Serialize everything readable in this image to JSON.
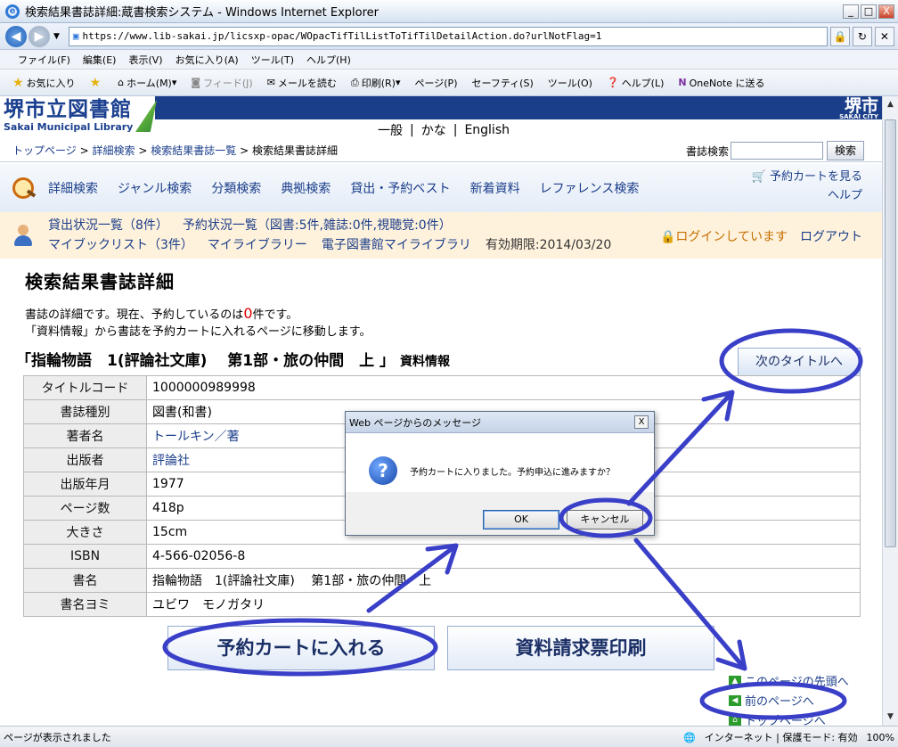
{
  "browser": {
    "window_title": "検索結果書誌詳細:蔵書検索システム - Windows Internet Explorer",
    "url": "https://www.lib-sakai.jp/licsxp-opac/WOpacTifTilListToTifTilDetailAction.do?urlNotFlag=1",
    "menu": [
      "ファイル(F)",
      "編集(E)",
      "表示(V)",
      "お気に入り(A)",
      "ツール(T)",
      "ヘルプ(H)"
    ],
    "favorites": {
      "fav_label": "お気に入り",
      "home": "ホーム(M)",
      "feed": "フィード(J)",
      "mail": "メールを読む",
      "print": "印刷(R)",
      "page": "ページ(P)",
      "safety": "セーフティ(S)",
      "tools": "ツール(O)",
      "help": "ヘルプ(L)",
      "onenote": "OneNote に送る"
    },
    "status": {
      "left": "ページが表示されました",
      "zone": "インターネット | 保護モード: 有効",
      "zoom": "100%"
    },
    "window_buttons": {
      "minimize": "_",
      "maximize": "□",
      "close": "X"
    }
  },
  "site": {
    "logo_jp": "堺市立図書館",
    "logo_en": "Sakai Municipal Library",
    "city": "堺市",
    "city_en": "SAKAI CITY",
    "lang": [
      "一般",
      "かな",
      "English"
    ],
    "lang_sep": "|"
  },
  "breadcrumb": {
    "items": [
      "トップページ",
      "詳細検索",
      "検索結果書誌一覧"
    ],
    "current": "検索結果書誌詳細",
    "separator": ">",
    "search_label": "書誌検索",
    "search_value": "",
    "search_button": "検索"
  },
  "nav": {
    "links": [
      "詳細検索",
      "ジャンル検索",
      "分類検索",
      "典拠検索",
      "貸出・予約ベスト",
      "新着資料",
      "レファレンス検索"
    ],
    "cart": "予約カートを見る",
    "help": "ヘルプ"
  },
  "user": {
    "loans": "貸出状況一覧（8件）",
    "reservations": "予約状況一覧（図書:5件,雑誌:0件,視聴覚:0件）",
    "mybook": "マイブックリスト（3件）",
    "mylibrary": "マイライブラリー",
    "ebook": "電子図書館マイライブラリ",
    "expiry": "有効期限:2014/03/20",
    "login_state": "ログインしています",
    "logout": "ログアウト"
  },
  "page": {
    "title": "検索結果書誌詳細",
    "desc1_pre": "書誌の詳細です。現在、予約しているのは",
    "desc1_count": "0",
    "desc1_post": "件です。",
    "desc2": "「資料情報」から書誌を予約カートに入れるページに移動します。",
    "book_title": "「指輪物語　1(評論社文庫)　 第1部・旅の仲間　上 」",
    "info_link": "資料情報",
    "next_title": "次のタイトルへ",
    "details": [
      {
        "key": "タイトルコード",
        "value": "1000000989998"
      },
      {
        "key": "書誌種別",
        "value": "図書(和書)"
      },
      {
        "key": "著者名",
        "value": "トールキン／著",
        "link": true
      },
      {
        "key": "出版者",
        "value": "評論社",
        "link": true
      },
      {
        "key": "出版年月",
        "value": "1977"
      },
      {
        "key": "ページ数",
        "value": "418p"
      },
      {
        "key": "大きさ",
        "value": "15cm"
      },
      {
        "key": "ISBN",
        "value": "4-566-02056-8"
      },
      {
        "key": "書名",
        "value": "指輪物語　1(評論社文庫)　 第1部・旅の仲間　上"
      },
      {
        "key": "書名ヨミ",
        "value": "ユビワ　モノガタリ"
      }
    ],
    "reserve_button": "予約カートに入れる",
    "print_button": "資料請求票印刷",
    "link_top": "このページの先頭へ",
    "link_prev": "前のページへ",
    "link_home": "トップページへ"
  },
  "dialog": {
    "title": "Web ページからのメッセージ",
    "message": "予約カートに入りました。予約申込に進みますか？",
    "ok": "OK",
    "cancel": "キャンセル",
    "close": "X",
    "icon": "question-icon"
  },
  "annotation_color": "#3a3fc8"
}
